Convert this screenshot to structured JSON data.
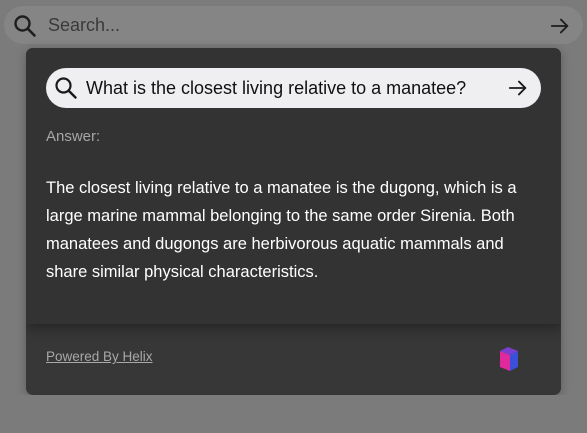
{
  "search": {
    "placeholder": "Search..."
  },
  "panel": {
    "query": "What is the closest living relative to a manatee?",
    "answer_label": "Answer:",
    "answer_text": "The closest living relative to a manatee is the dugong, which is a large marine mammal belonging to the same order Sirenia. Both manatees and dugongs are herbivorous aquatic mammals and share similar physical characteristics.",
    "footer_link": "Powered By Helix"
  },
  "icons": {
    "search": "search-icon",
    "submit": "arrow-right-icon",
    "logo": "helix-logo"
  },
  "colors": {
    "backdrop": "#7b7b7b",
    "panel": "#373737",
    "query_bar": "#efeff1",
    "logo_magenta": "#e0299b",
    "logo_blue": "#3b4fd8"
  }
}
